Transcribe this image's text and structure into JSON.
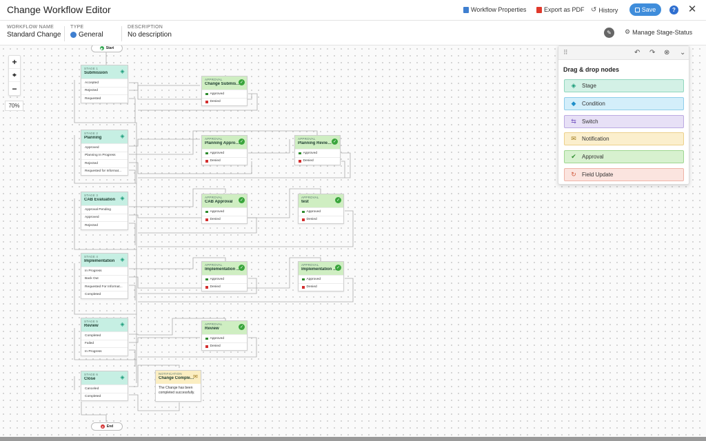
{
  "app": {
    "title": "Change Workflow Editor"
  },
  "toolbar": {
    "workflow_properties": "Workflow Properties",
    "export_pdf": "Export as PDF",
    "history": "History",
    "save": "Save",
    "help": "?"
  },
  "info": {
    "name_label": "WORKFLOW NAME",
    "name_value": "Standard Change",
    "type_label": "TYPE",
    "type_value": "General",
    "desc_label": "DESCRIPTION",
    "desc_value": "No description",
    "manage": "Manage Stage-Status"
  },
  "zoom": {
    "level": "70%"
  },
  "panel": {
    "title": "Drag & drop nodes",
    "items": [
      {
        "label": "Stage",
        "color": "#d3f1e6",
        "border": "#8fd6bd"
      },
      {
        "label": "Condition",
        "color": "#d3eefa",
        "border": "#8dcdea"
      },
      {
        "label": "Switch",
        "color": "#e7e0f6",
        "border": "#bba9e2"
      },
      {
        "label": "Notification",
        "color": "#fbefcd",
        "border": "#ecd08a"
      },
      {
        "label": "Approval",
        "color": "#d7f1cf",
        "border": "#9ed690"
      },
      {
        "label": "Field Update",
        "color": "#fbe4df",
        "border": "#efb3a6"
      }
    ]
  },
  "terminals": {
    "start": "Start",
    "end": "End"
  },
  "stages": [
    {
      "type": "STAGE 1",
      "title": "Submission",
      "rows": [
        "Accepted",
        "Rejected",
        "Requested"
      ]
    },
    {
      "type": "STAGE 2",
      "title": "Planning",
      "rows": [
        "Approved",
        "Planning In Progress",
        "Rejected",
        "Requested for Informat..."
      ]
    },
    {
      "type": "STAGE 3",
      "title": "CAB Evaluation",
      "rows": [
        "Approval Pending",
        "Approved",
        "Rejected"
      ]
    },
    {
      "type": "STAGE 4",
      "title": "Implementation",
      "rows": [
        "In Progress",
        "Back Out",
        "Requested For Informat...",
        "Completed"
      ]
    },
    {
      "type": "STAGE 5",
      "title": "Review",
      "rows": [
        "Completed",
        "Failed",
        "In Progress"
      ]
    },
    {
      "type": "STAGE 6",
      "title": "Close",
      "rows": [
        "Canceled",
        "Completed"
      ]
    }
  ],
  "approvals": [
    {
      "type": "APPROVAL",
      "title": "Change Submissio...",
      "rows": [
        "Approved",
        "Denied"
      ]
    },
    {
      "type": "APPROVAL",
      "title": "Planning Approval",
      "rows": [
        "Approved",
        "Denied"
      ]
    },
    {
      "type": "APPROVAL",
      "title": "Planning Review ...",
      "rows": [
        "Approved",
        "Denied"
      ]
    },
    {
      "type": "APPROVAL",
      "title": "CAB Approval",
      "rows": [
        "Approved",
        "Denied"
      ]
    },
    {
      "type": "APPROVAL",
      "title": "test",
      "rows": [
        "Approved",
        "Denied"
      ]
    },
    {
      "type": "APPROVAL",
      "title": "Implementation ...",
      "rows": [
        "Approved",
        "Denied"
      ]
    },
    {
      "type": "APPROVAL",
      "title": "Implementation ...",
      "rows": [
        "Approved",
        "Denied"
      ]
    },
    {
      "type": "APPROVAL",
      "title": "Review",
      "rows": [
        "Approved",
        "Denied"
      ]
    }
  ],
  "notification": {
    "type": "NOTIFICATION",
    "title": "Change Completed",
    "text": "The Change has been completed successfully."
  }
}
